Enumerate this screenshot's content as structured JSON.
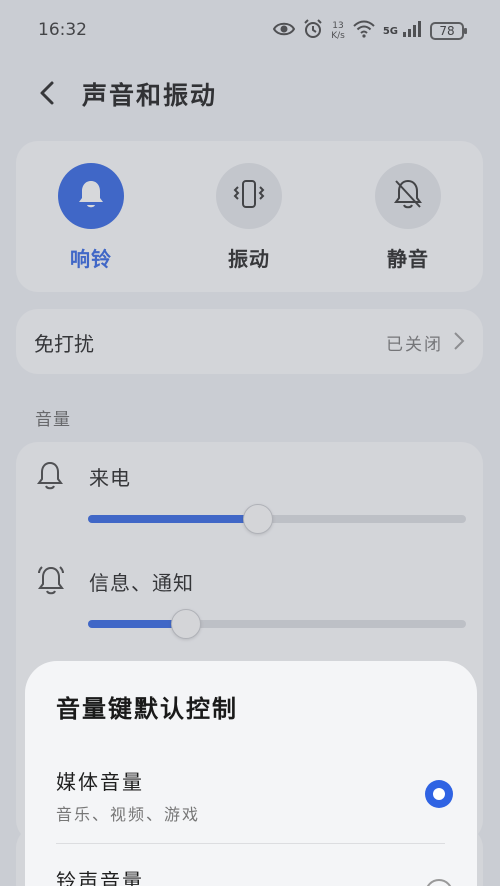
{
  "status_bar": {
    "time": "16:32",
    "net_speed_value": "13",
    "net_speed_unit": "K/s",
    "network_badge": "5G",
    "battery": "78",
    "icons": [
      "eye-icon",
      "alarm-icon",
      "wifi-icon",
      "signal-icon",
      "battery-icon"
    ]
  },
  "header": {
    "title": "声音和振动"
  },
  "modes": [
    {
      "label": "响铃",
      "icon": "bell-icon",
      "active": true
    },
    {
      "label": "振动",
      "icon": "vibrate-icon",
      "active": false
    },
    {
      "label": "静音",
      "icon": "bell-off-icon",
      "active": false
    }
  ],
  "dnd": {
    "title": "免打扰",
    "status": "已关闭"
  },
  "volume_section": {
    "label": "音量",
    "items": [
      {
        "label": "来电",
        "icon": "bell-icon",
        "level": 0.45
      },
      {
        "label": "信息、通知",
        "icon": "notification-bell-icon",
        "level": 0.26
      }
    ]
  },
  "sheet": {
    "title": "音量键默认控制",
    "options": [
      {
        "title": "媒体音量",
        "subtitle": "音乐、视频、游戏",
        "selected": true
      },
      {
        "title": "铃声音量",
        "subtitle": "",
        "selected": false
      }
    ]
  },
  "colors": {
    "accent": "#2f63e3",
    "background": "#eef0f4",
    "card": "#fafbfd"
  }
}
